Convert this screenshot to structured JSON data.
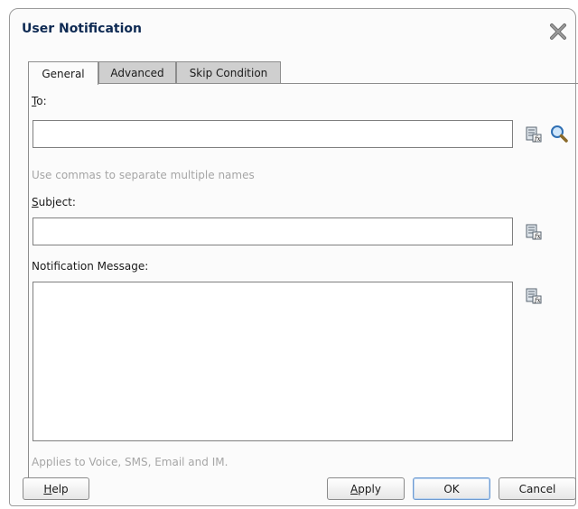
{
  "dialog": {
    "title": "User Notification"
  },
  "tabs": [
    {
      "label": "General",
      "active": true
    },
    {
      "label": "Advanced",
      "active": false
    },
    {
      "label": "Skip Condition",
      "active": false
    }
  ],
  "fields": {
    "to": {
      "label_mnemonic": "T",
      "label_rest": "o:",
      "value": "",
      "placeholder": ""
    },
    "to_hint": "Use commas to separate multiple names",
    "subject": {
      "label_mnemonic": "S",
      "label_rest": "ubject:",
      "value": ""
    },
    "message": {
      "label": "Notification Message:",
      "value": ""
    },
    "message_hint": "Applies to Voice, SMS, Email and IM."
  },
  "buttons": {
    "help": {
      "mnemonic": "H",
      "rest": "elp"
    },
    "apply": {
      "mnemonic": "A",
      "rest": "pply"
    },
    "ok": "OK",
    "cancel": "Cancel"
  },
  "icons": {
    "close": "close-icon",
    "expression_builder": "expression-builder-icon",
    "search": "search-icon"
  },
  "colors": {
    "title": "#0e2a53",
    "hint": "#a6a6a6",
    "tab_inactive": "#cfcfcf",
    "default_button_border": "#6f9bd1"
  }
}
